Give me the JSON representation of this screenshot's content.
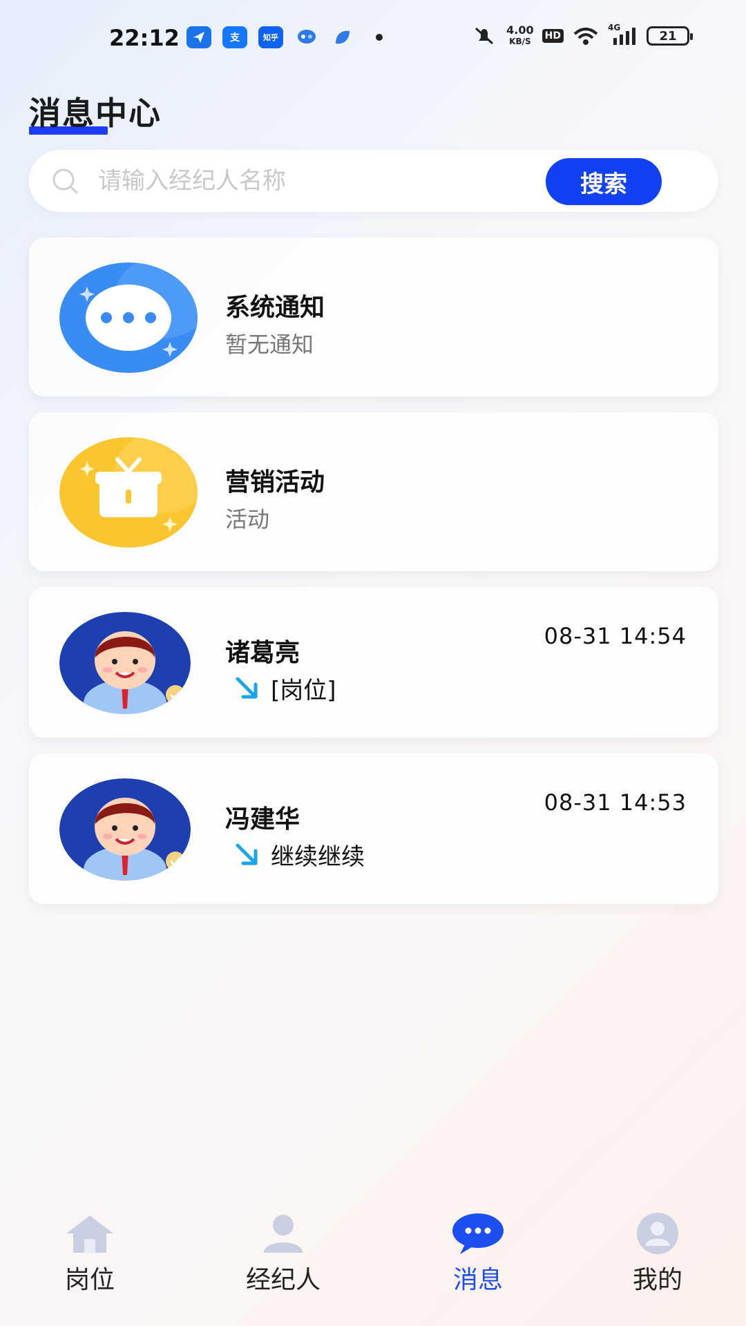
{
  "status_bar": {
    "time": "22:12",
    "net_speed_value": "4.00",
    "net_speed_unit": "KB/S",
    "hd": "HD",
    "network": "4G",
    "battery": "21",
    "apps": [
      {
        "icon": "paper-plane-icon",
        "color": "#1a73e8"
      },
      {
        "icon": "alipay-icon",
        "color": "#1677ff",
        "text": "支"
      },
      {
        "icon": "zhihu-icon",
        "color": "#0f63f0",
        "text": "知乎"
      },
      {
        "icon": "chat-bubble-icon",
        "color": "#2c7be5"
      },
      {
        "icon": "leaf-icon",
        "color": "#2f7be8"
      }
    ]
  },
  "header": {
    "title": "消息中心"
  },
  "search": {
    "placeholder": "请输入经纪人名称",
    "button_label": "搜索"
  },
  "messages": [
    {
      "type": "system",
      "avatar": "chat-bubble-icon",
      "title": "系统通知",
      "subtitle": "暂无通知",
      "accent": "#3a8cf5"
    },
    {
      "type": "marketing",
      "avatar": "gift-box-icon",
      "title": "营销活动",
      "subtitle": "活动",
      "accent": "#fbc530"
    },
    {
      "type": "chat",
      "avatar": "agent-avatar",
      "title": "诸葛亮",
      "time": "08-31 14:54",
      "preview": "[岗位]"
    },
    {
      "type": "chat",
      "avatar": "agent-avatar",
      "title": "冯建华",
      "time": "08-31 14:53",
      "preview": "继续继续"
    }
  ],
  "tabs": [
    {
      "label": "岗位",
      "icon": "home-icon",
      "active": false
    },
    {
      "label": "经纪人",
      "icon": "person-icon",
      "active": false
    },
    {
      "label": "消息",
      "icon": "message-icon",
      "active": true
    },
    {
      "label": "我的",
      "icon": "profile-icon",
      "active": false
    }
  ],
  "colors": {
    "accent": "#1240f3",
    "active_tab": "#1d4ef0",
    "arrow": "#1aa6e6"
  }
}
